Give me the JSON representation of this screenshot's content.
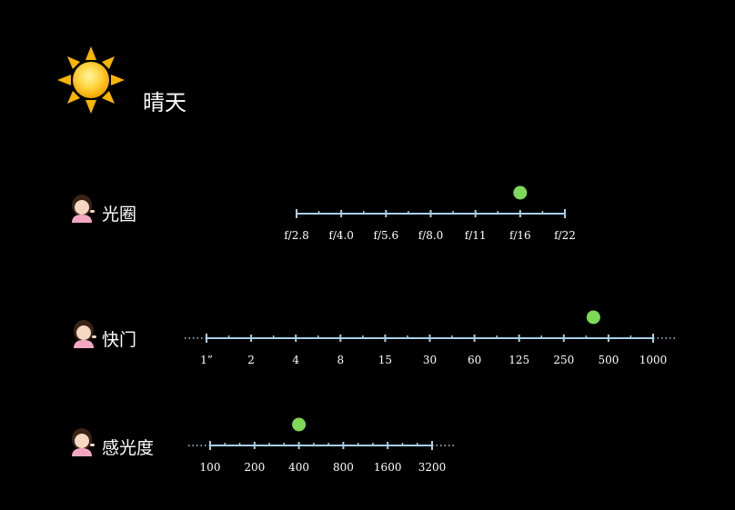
{
  "header": {
    "title": "晴天",
    "icon": "sun-icon"
  },
  "colors": {
    "scale": "#a8d0e6",
    "marker": "#7ed957",
    "background": "#000000"
  },
  "scales": [
    {
      "id": "aperture",
      "label": "光圈",
      "icon": "person-info-icon",
      "ticks": [
        "f/2.8",
        "f/4.0",
        "f/5.6",
        "f/8.0",
        "f/11",
        "f/16",
        "f/22"
      ],
      "selected": "f/16",
      "minor_per_interval": 1,
      "dotted_ends": false
    },
    {
      "id": "shutter",
      "label": "快门",
      "icon": "person-info-icon",
      "ticks": [
        "1”",
        "2",
        "4",
        "8",
        "15",
        "30",
        "60",
        "125",
        "250",
        "500",
        "1000"
      ],
      "selected_between": [
        "250",
        "500"
      ],
      "minor_per_interval": 1,
      "dotted_ends": true
    },
    {
      "id": "iso",
      "label": "感光度",
      "icon": "person-info-icon",
      "ticks": [
        "100",
        "200",
        "400",
        "800",
        "1600",
        "3200"
      ],
      "selected": "400",
      "minor_per_interval": 2,
      "dotted_ends": true
    }
  ]
}
